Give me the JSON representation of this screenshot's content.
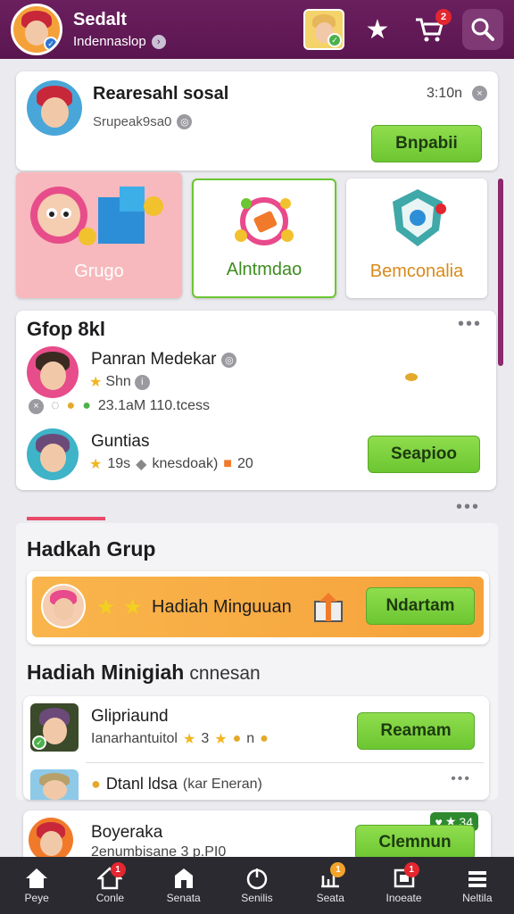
{
  "header": {
    "title": "Sedalt",
    "subtitle": "Indennaslop",
    "cart_badge": "2"
  },
  "notification": {
    "title": "Rearesahl sosal",
    "time": "3:10n",
    "subtitle": "Srupeak9sa0",
    "button": "Bnpabii"
  },
  "tiles": [
    {
      "label": "Grugo"
    },
    {
      "label": "Alntmdao"
    },
    {
      "label": "Bemconalia"
    }
  ],
  "group_list": {
    "title": "Gfop 8kl",
    "items": [
      {
        "name": "Panran Medekar",
        "meta": "Shn",
        "extra": "23.1aM  110.tcess"
      },
      {
        "name": "Guntias",
        "meta": "19s",
        "extra": "knesdoak)",
        "count": "20",
        "button": "Seapioo"
      }
    ]
  },
  "hadiah_grup": {
    "title": "Hadkah Grup",
    "banner_text": "Hadiah Minguuan",
    "banner_button": "Ndartam"
  },
  "weekly": {
    "title": "Hadiah Minigiah",
    "subtitle": "cnnesan",
    "rows": [
      {
        "name": "Glipriaund",
        "detail": "Ianarhantuitol",
        "stars": "3",
        "suffix": "n",
        "button": "Reamam"
      },
      {
        "name": "Dtanl ldsa",
        "detail": "(kar Eneran)"
      }
    ]
  },
  "last_card": {
    "name": "Boyeraka",
    "detail": "2enumbisane 3 p.PI0",
    "badge": "34",
    "button": "Clemnun"
  },
  "nav": [
    {
      "label": "Peye",
      "icon": "home-icon"
    },
    {
      "label": "Conle",
      "icon": "house-icon",
      "badge": "1"
    },
    {
      "label": "Senata",
      "icon": "shop-icon"
    },
    {
      "label": "Senilis",
      "icon": "power-icon"
    },
    {
      "label": "Seata",
      "icon": "chart-icon",
      "badge": "1"
    },
    {
      "label": "Inoeate",
      "icon": "frame-icon",
      "badge": "1"
    },
    {
      "label": "Neltila",
      "icon": "menu-icon"
    }
  ],
  "colors": {
    "header": "#5a1650",
    "accent_green": "#6cc631",
    "badge_red": "#e3262f",
    "banner_orange": "#f6a23b"
  }
}
